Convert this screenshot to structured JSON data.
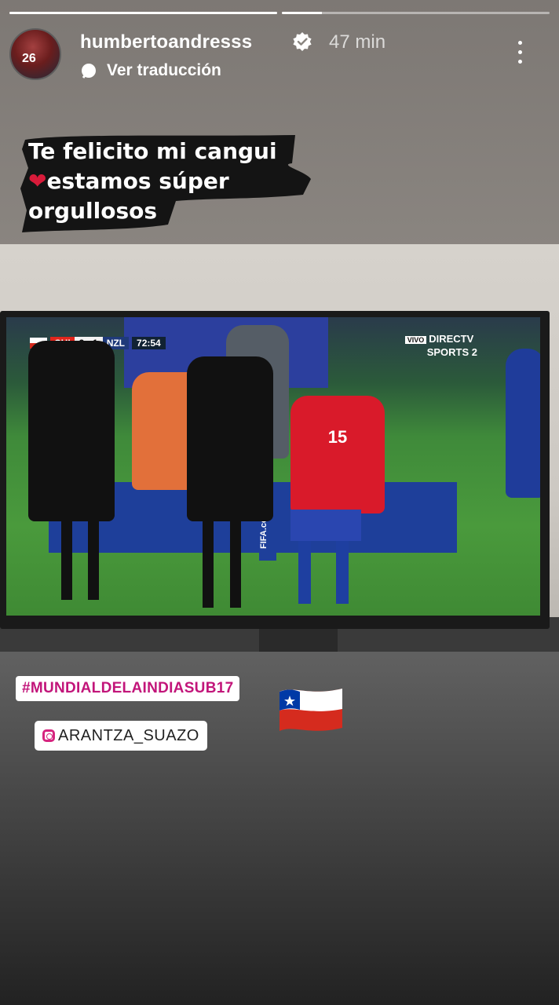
{
  "story": {
    "progress": [
      1.0,
      0.15
    ]
  },
  "header": {
    "username": "humbertoandresss",
    "time_ago": "47 min",
    "translate_label": "Ver traducción",
    "avatar_icon": "profile-avatar",
    "verified_icon": "verified-badge-icon",
    "more_icon": "more-options-icon"
  },
  "caption": {
    "line1": "Te felicito mi cangui",
    "heart": "❤",
    "line2": "estamos súper",
    "line3": "orgullosos"
  },
  "photo": {
    "scorebug": {
      "home": "CHI",
      "score": "3 · 1",
      "away": "NZL",
      "clock": "72:54"
    },
    "broadcaster_live": "VIVO",
    "broadcaster_line1": "DIRECTV",
    "broadcaster_line2": "SPORTS 2",
    "player_number": "15",
    "board_text": "FIFA.com"
  },
  "stickers": {
    "hashtag": "#MUNDIALDELAINDIASUB17",
    "mention": "ARANTZA_SUAZO",
    "flag": "chile-flag"
  },
  "colors": {
    "hashtag": "#c2157a",
    "heart": "#d81b3a",
    "chile_red": "#d52b1e",
    "chile_blue": "#0039a6"
  }
}
